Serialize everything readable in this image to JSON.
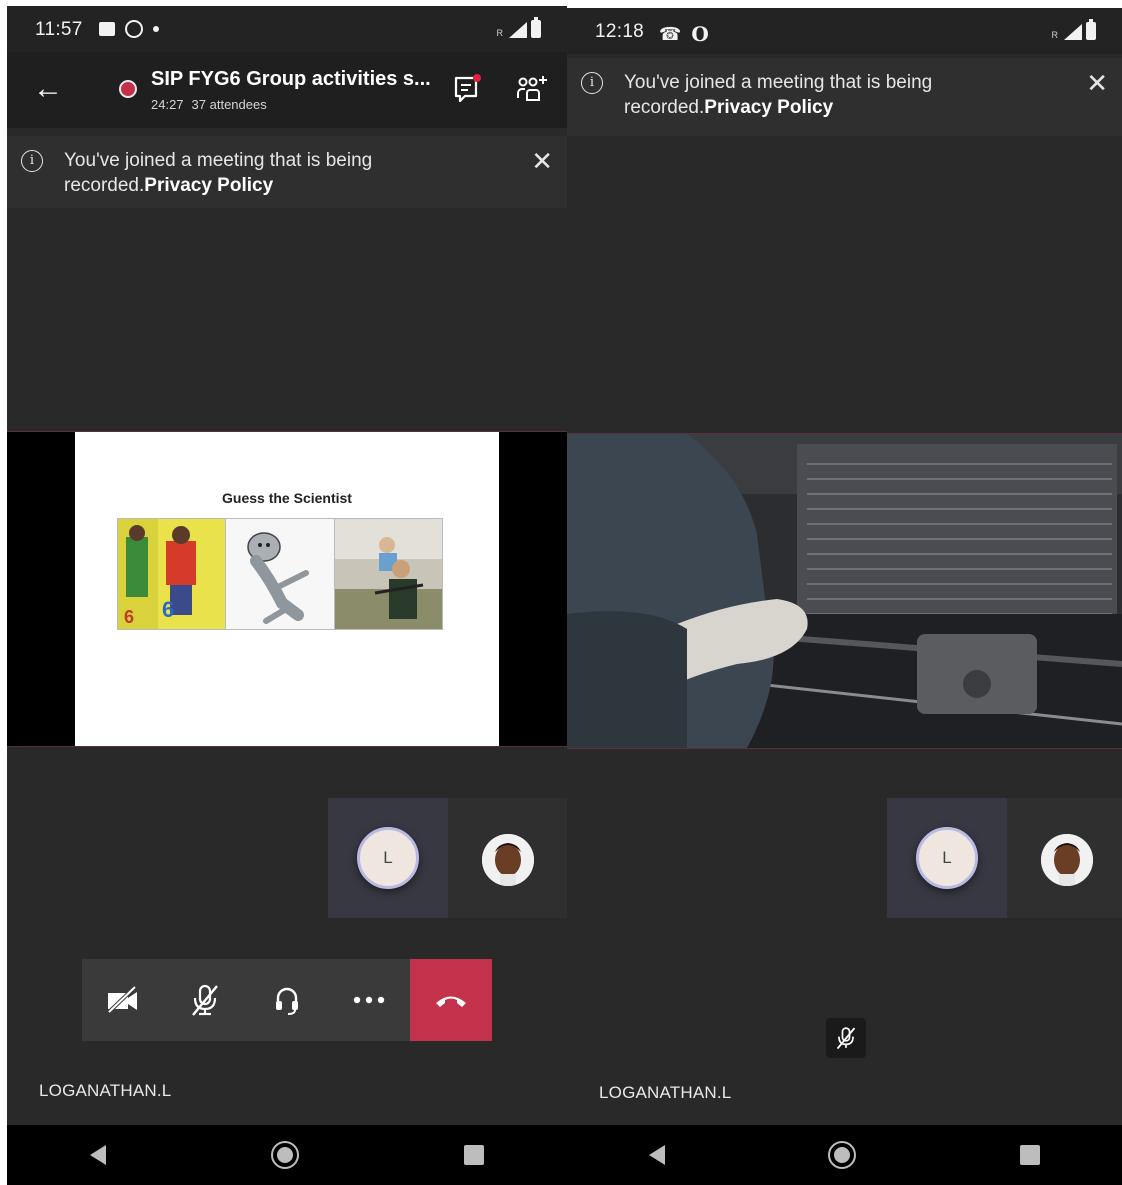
{
  "left": {
    "status": {
      "time": "11:57",
      "network_label": "R"
    },
    "header": {
      "title": "SIP FYG6 Group activities s...",
      "duration": "24:27",
      "attendees": "37 attendees"
    },
    "banner": {
      "message": "You've joined a meeting that is being recorded.",
      "link": "Privacy Policy"
    },
    "slide": {
      "title": "Guess the Scientist"
    },
    "participant": {
      "initial": "L",
      "name": "LOGANATHAN.L"
    },
    "controls": [
      "camera-off",
      "mic-off",
      "speaker",
      "more",
      "hang-up"
    ]
  },
  "right": {
    "status": {
      "time": "12:18",
      "network_label": "R"
    },
    "banner": {
      "message": "You've joined a meeting that is being recorded.",
      "link": "Privacy Policy"
    },
    "participant": {
      "initial": "L",
      "name": "LOGANATHAN.L"
    }
  },
  "colors": {
    "accent_red": "#c4314b",
    "background": "#292929",
    "avatar_ring": "#b9b9e4"
  }
}
